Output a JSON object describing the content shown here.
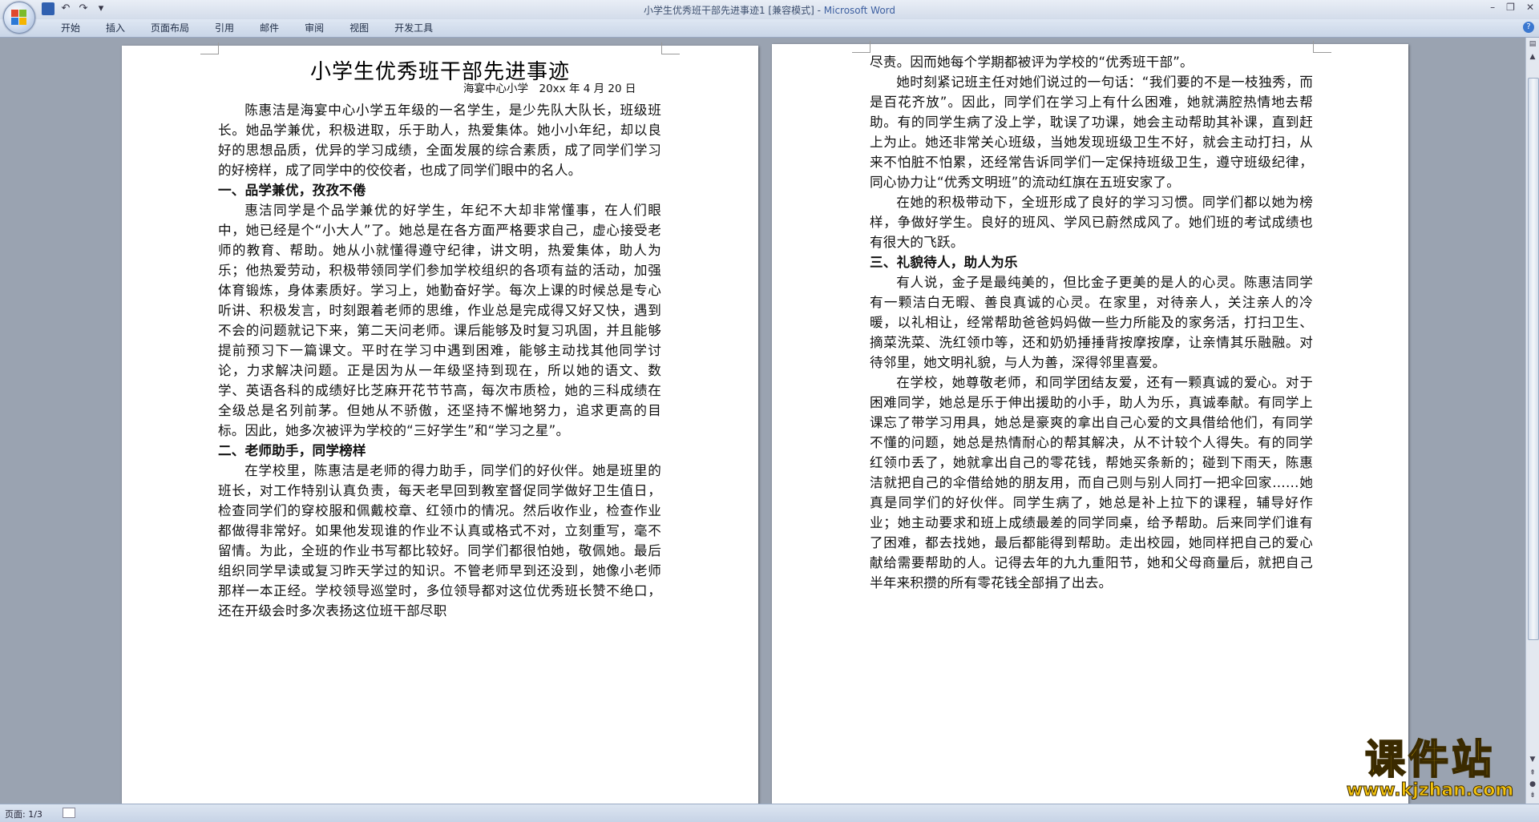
{
  "window": {
    "title": "小学生优秀班干部先进事迹1 [兼容模式] -",
    "app_name": "Microsoft Word"
  },
  "ribbon_tabs": [
    "开始",
    "插入",
    "页面布局",
    "引用",
    "邮件",
    "审阅",
    "视图",
    "开发工具"
  ],
  "document": {
    "heading": "小学生优秀班干部先进事迹",
    "byline": "海宴中心小学　20xx 年 4 月 20 日",
    "page1": [
      {
        "type": "p",
        "text": "陈惠洁是海宴中心小学五年级的一名学生，是少先队大队长，班级班长。她品学兼优，积极进取，乐于助人，热爱集体。她小小年纪，却以良好的思想品质，优异的学习成绩，全面发展的综合素质，成了同学们学习的好榜样，成了同学中的佼佼者，也成了同学们眼中的名人。"
      },
      {
        "type": "h",
        "text": "一、品学兼优，孜孜不倦"
      },
      {
        "type": "p",
        "text": "惠洁同学是个品学兼优的好学生，年纪不大却非常懂事，在人们眼中，她已经是个“小大人”了。她总是在各方面严格要求自己，虚心接受老师的教育、帮助。她从小就懂得遵守纪律，讲文明，热爱集体，助人为乐；他热爱劳动，积极带领同学们参加学校组织的各项有益的活动，加强体育锻炼，身体素质好。学习上，她勤奋好学。每次上课的时候总是专心听讲、积极发言，时刻跟着老师的思维，作业总是完成得又好又快，遇到不会的问题就记下来，第二天问老师。课后能够及时复习巩固，并且能够提前预习下一篇课文。平时在学习中遇到困难，能够主动找其他同学讨论，力求解决问题。正是因为从一年级坚持到现在，所以她的语文、数学、英语各科的成绩好比芝麻开花节节高，每次市质检，她的三科成绩在全级总是名列前茅。但她从不骄傲，还坚持不懈地努力，追求更高的目标。因此，她多次被评为学校的“三好学生”和“学习之星”。"
      },
      {
        "type": "h",
        "text": "二、老师助手，同学榜样"
      },
      {
        "type": "p",
        "text": "在学校里，陈惠洁是老师的得力助手，同学们的好伙伴。她是班里的班长，对工作特别认真负责，每天老早回到教室督促同学做好卫生值日，检查同学们的穿校服和佩戴校章、红领巾的情况。然后收作业，检查作业都做得非常好。如果他发现谁的作业不认真或格式不对，立刻重写，毫不留情。为此，全班的作业书写都比较好。同学们都很怕她，敬佩她。最后组织同学早读或复习昨天学过的知识。不管老师早到还没到，她像小老师那样一本正经。学校领导巡堂时，多位领导都对这位优秀班长赞不绝口，还在开级会时多次表扬这位班干部尽职"
      }
    ],
    "page2": [
      {
        "type": "cont",
        "text": "尽责。因而她每个学期都被评为学校的“优秀班干部”。"
      },
      {
        "type": "p",
        "text": "她时刻紧记班主任对她们说过的一句话：“我们要的不是一枝独秀，而是百花齐放”。因此，同学们在学习上有什么困难，她就满腔热情地去帮助。有的同学生病了没上学，耽误了功课，她会主动帮助其补课，直到赶上为止。她还非常关心班级，当她发现班级卫生不好，就会主动打扫，从来不怕脏不怕累，还经常告诉同学们一定保持班级卫生，遵守班级纪律，同心协力让“优秀文明班”的流动红旗在五班安家了。"
      },
      {
        "type": "p",
        "text": "在她的积极带动下，全班形成了良好的学习习惯。同学们都以她为榜样，争做好学生。良好的班风、学风已蔚然成风了。她们班的考试成绩也有很大的飞跃。"
      },
      {
        "type": "h",
        "text": "三、礼貌待人，助人为乐"
      },
      {
        "type": "p",
        "text": "有人说，金子是最纯美的，但比金子更美的是人的心灵。陈惠洁同学有一颗洁白无暇、善良真诚的心灵。在家里，对待亲人，关注亲人的冷暖，以礼相让，经常帮助爸爸妈妈做一些力所能及的家务活，打扫卫生、摘菜洗菜、洗红领巾等，还和奶奶捶捶背按摩按摩，让亲情其乐融融。对待邻里，她文明礼貌，与人为善，深得邻里喜爱。"
      },
      {
        "type": "p",
        "text": "在学校，她尊敬老师，和同学团结友爱，还有一颗真诚的爱心。对于困难同学，她总是乐于伸出援助的小手，助人为乐，真诚奉献。有同学上课忘了带学习用具，她总是豪爽的拿出自己心爱的文具借给他们，有同学不懂的问题，她总是热情耐心的帮其解决，从不计较个人得失。有的同学红领巾丢了，她就拿出自己的零花钱，帮她买条新的；碰到下雨天，陈惠洁就把自己的伞借给她的朋友用，而自己则与别人同打一把伞回家……她真是同学们的好伙伴。同学生病了，她总是补上拉下的课程，辅导好作业；她主动要求和班上成绩最差的同学同桌，给予帮助。后来同学们谁有了困难，都去找她，最后都能得到帮助。走出校园，她同样把自己的爱心献给需要帮助的人。记得去年的九九重阳节，她和父母商量后，就把自己半年来积攒的所有零花钱全部捐了出去。"
      }
    ]
  },
  "status": {
    "page": "页面: 1/3"
  },
  "watermark": {
    "brand": "课件站",
    "url": "www.kjzhan.com"
  },
  "colors": {
    "workspace": "#9aa3b1",
    "ribbon": "#dfe7f3",
    "watermark": "#f3c20d"
  }
}
